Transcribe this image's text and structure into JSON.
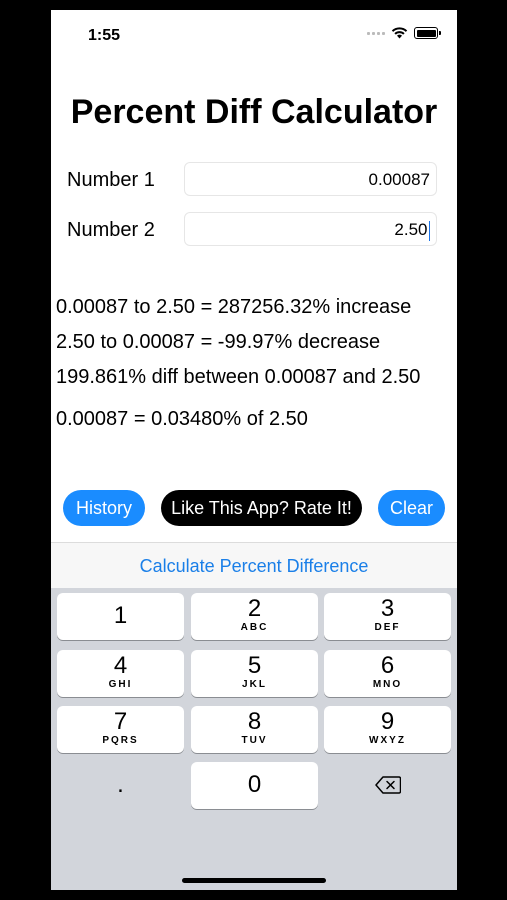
{
  "status": {
    "time": "1:55"
  },
  "title": "Percent Diff Calculator",
  "inputs": {
    "number1_label": "Number 1",
    "number1_value": "0.00087",
    "number2_label": "Number 2",
    "number2_value": "2.50"
  },
  "results": {
    "line1": "0.00087 to 2.50 = 287256.32% increase",
    "line2": "2.50 to 0.00087 = -99.97% decrease",
    "line3": "199.861% diff between 0.00087 and 2.50",
    "line4": "0.00087 = 0.03480% of 2.50"
  },
  "buttons": {
    "history": "History",
    "rate": "Like This App? Rate It!",
    "clear": "Clear",
    "calculate": "Calculate Percent Difference"
  },
  "keyboard": {
    "keys": [
      {
        "num": "1",
        "letters": ""
      },
      {
        "num": "2",
        "letters": "ABC"
      },
      {
        "num": "3",
        "letters": "DEF"
      },
      {
        "num": "4",
        "letters": "GHI"
      },
      {
        "num": "5",
        "letters": "JKL"
      },
      {
        "num": "6",
        "letters": "MNO"
      },
      {
        "num": "7",
        "letters": "PQRS"
      },
      {
        "num": "8",
        "letters": "TUV"
      },
      {
        "num": "9",
        "letters": "WXYZ"
      }
    ],
    "decimal": ".",
    "zero": "0",
    "delete_icon": "backspace-icon"
  },
  "colors": {
    "accent": "#1a8cff",
    "link": "#1a7fe8",
    "keyboard_bg": "#d2d5db"
  }
}
